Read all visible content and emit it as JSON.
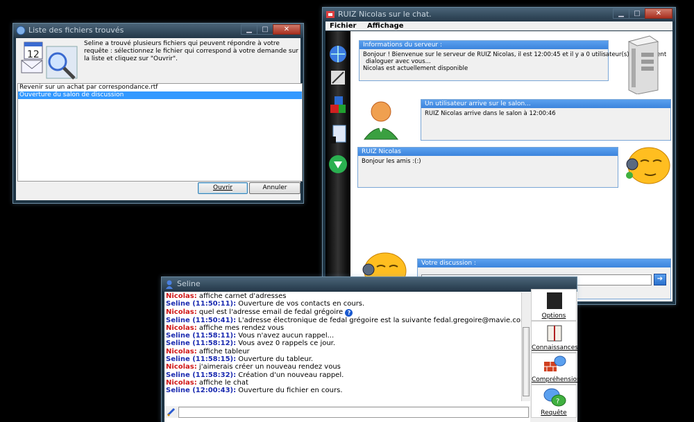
{
  "file_window": {
    "title": "Liste des fichiers trouvés",
    "description": "Seline a trouvé plusieurs fichiers qui peuvent répondre à votre requête : sélectionnez le fichier qui correspond à votre demande sur la liste et cliquez sur \"Ouvrir\".",
    "items": [
      {
        "label": "Revenir sur un achat par correspondance.rtf",
        "selected": false
      },
      {
        "label": "Ouverture du salon de discussion",
        "selected": true
      }
    ],
    "open_label": "Ouvrir",
    "cancel_label": "Annuler"
  },
  "chat_window": {
    "title": "RUIZ Nicolas sur le chat.",
    "menu": [
      "Fichier",
      "Affichage"
    ],
    "server_panel": {
      "title": "Informations du serveur :",
      "lines": [
        "Bonjour ! Bienvenue sur le serveur de RUIZ Nicolas, il est 12:00:45 et il y a 0 utilisateur(s) qui peuvent",
        "dialoguer avec vous...",
        "Nicolas est actuellement disponible"
      ]
    },
    "arrival_panel": {
      "title": "Un utilisateur arrive sur le salon...",
      "text": "RUIZ Nicolas arrive dans le salon à 12:00:46"
    },
    "user_panel": {
      "title": "RUIZ Nicolas",
      "text": "Bonjour les amis :(:)"
    },
    "discussion_panel": {
      "title": "Votre discussion :",
      "value": ""
    }
  },
  "seline_window": {
    "title": "Seline",
    "messages": [
      {
        "who": "Nicolas:",
        "role": "user",
        "text": " affiche carnet d'adresses"
      },
      {
        "who": "Seline (11:50:11):",
        "role": "bot",
        "text": " Ouverture de vos contacts en cours."
      },
      {
        "who": "Nicolas:",
        "role": "user",
        "text": " quel est l'adresse email de fedal grégoire"
      },
      {
        "who": "Seline (11:50:41):",
        "role": "bot",
        "text": " L'adresse électronique de fedal grégoire est la suivante fedal.gregoire@mavie.com."
      },
      {
        "who": "Nicolas:",
        "role": "user",
        "text": " affiche mes rendez vous"
      },
      {
        "who": "Seline (11:58:11):",
        "role": "bot",
        "text": " Vous n'avez aucun rappel..."
      },
      {
        "who": "Seline (11:58:12):",
        "role": "bot",
        "text": " Vous avez 0 rappels ce jour."
      },
      {
        "who": "Nicolas:",
        "role": "user",
        "text": " affiche tableur"
      },
      {
        "who": "Seline (11:58:15):",
        "role": "bot",
        "text": " Ouverture du tableur."
      },
      {
        "who": "Nicolas:",
        "role": "user",
        "text": " j'aimerais créer un nouveau rendez vous"
      },
      {
        "who": "Seline (11:58:32):",
        "role": "bot",
        "text": " Création d'un nouveau rappel."
      },
      {
        "who": "Nicolas:",
        "role": "user",
        "text": " affiche le chat"
      },
      {
        "who": "Seline (12:00:43):",
        "role": "bot",
        "text": " Ouverture du fichier en cours."
      }
    ],
    "side_buttons": [
      "Options",
      "Connaissances",
      "Compréhension",
      "Requête"
    ],
    "input_value": ""
  }
}
